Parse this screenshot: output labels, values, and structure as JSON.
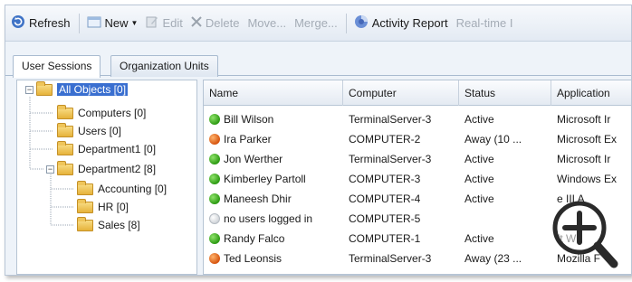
{
  "toolbar": {
    "refresh": "Refresh",
    "new": "New",
    "edit": "Edit",
    "delete": "Delete",
    "move": "Move...",
    "merge": "Merge...",
    "activity_report": "Activity Report",
    "realtime": "Real-time I"
  },
  "tabs": [
    "User Sessions",
    "Organization Units"
  ],
  "tree": {
    "root": "All Objects [0]",
    "items": [
      "Computers [0]",
      "Users [0]",
      "Department1 [0]",
      "Department2 [8]",
      "Accounting [0]",
      "HR [0]",
      "Sales [8]"
    ]
  },
  "grid": {
    "columns": [
      "Name",
      "Computer",
      "Status",
      "Application"
    ],
    "rows": [
      {
        "status_icon": "green",
        "name": "Bill Wilson",
        "computer": "TerminalServer-3",
        "status": "Active",
        "application": "Microsoft Ir"
      },
      {
        "status_icon": "orange",
        "name": "Ira Parker",
        "computer": "COMPUTER-2",
        "status": "Away (10 ...",
        "application": "Microsoft Ex"
      },
      {
        "status_icon": "green",
        "name": "Jon Werther",
        "computer": "TerminalServer-3",
        "status": "Active",
        "application": "Microsoft Ir"
      },
      {
        "status_icon": "green",
        "name": "Kimberley Partoll",
        "computer": "COMPUTER-3",
        "status": "Active",
        "application": "Windows Ex"
      },
      {
        "status_icon": "green",
        "name": "Maneesh Dhir",
        "computer": "COMPUTER-4",
        "status": "Active",
        "application": "e III A"
      },
      {
        "status_icon": "gray",
        "name": "no users logged in",
        "computer": "COMPUTER-5",
        "status": "",
        "application": ""
      },
      {
        "status_icon": "green",
        "name": "Randy Falco",
        "computer": "COMPUTER-1",
        "status": "Active",
        "application": "ft W"
      },
      {
        "status_icon": "orange",
        "name": "Ted Leonsis",
        "computer": "TerminalServer-3",
        "status": "Away (23 ...",
        "application": "Mozilla F"
      }
    ]
  },
  "colors": {
    "selection": "#3a6fd0",
    "active": "#2c9a12",
    "away": "#d6540f"
  },
  "icons": [
    "refresh-icon",
    "new-icon",
    "edit-icon",
    "delete-icon",
    "activity-report-icon",
    "zoom-in-icon"
  ]
}
